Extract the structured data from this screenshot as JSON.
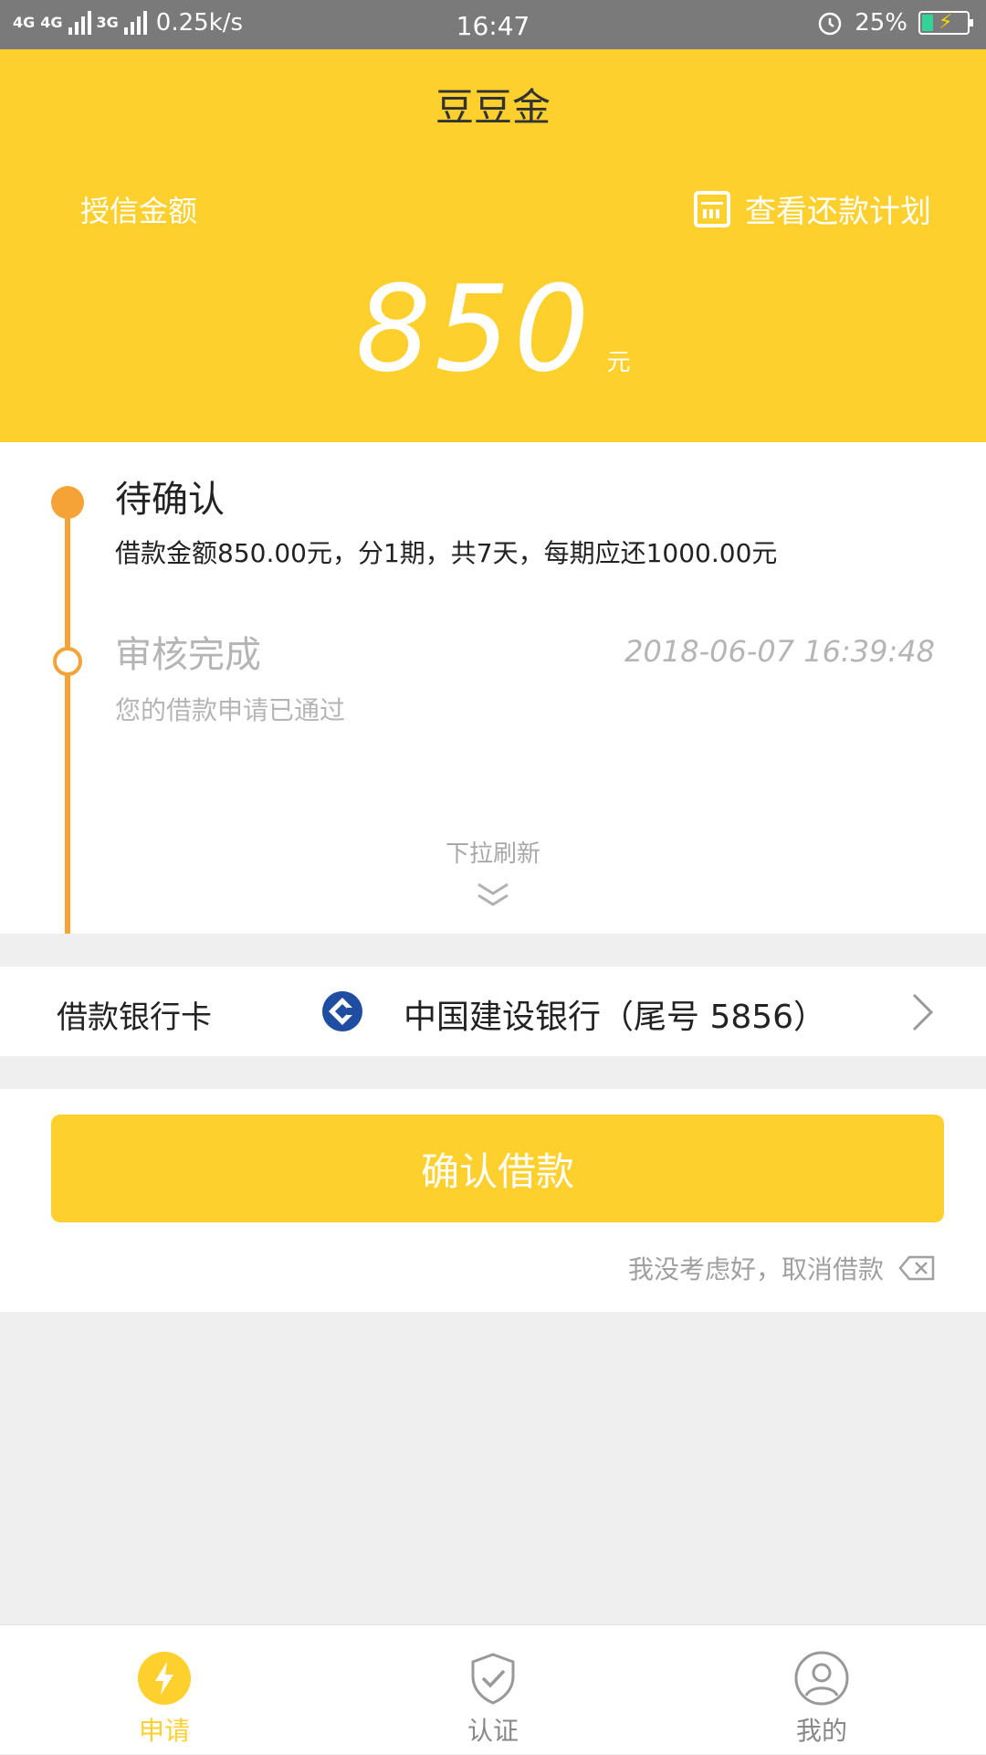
{
  "status_bar": {
    "signal_1": "4G",
    "signal_2": "4G",
    "signal_3": "3G",
    "speed": "0.25k/s",
    "time": "16:47",
    "battery": "25%"
  },
  "header": {
    "title": "豆豆金",
    "credit_label": "授信金额",
    "plan_link": "查看还款计划",
    "amount": "850",
    "amount_unit": "元"
  },
  "timeline": {
    "step1_title": "待确认",
    "step1_desc": "借款金额850.00元，分1期，共7天，每期应还1000.00元",
    "step2_title": "审核完成",
    "step2_time": "2018-06-07 16:39:48",
    "step2_desc": "您的借款申请已通过",
    "refresh_hint": "下拉刷新"
  },
  "bank": {
    "label": "借款银行卡",
    "name": "中国建设银行（尾号 5856）"
  },
  "actions": {
    "confirm_label": "确认借款",
    "cancel_label": "我没考虑好，取消借款"
  },
  "tabs": [
    {
      "label": "申请"
    },
    {
      "label": "认证"
    },
    {
      "label": "我的"
    }
  ],
  "colors": {
    "brand_yellow": "#fed02d",
    "timeline_orange": "#f5a237",
    "bank_blue": "#1e4da1"
  }
}
